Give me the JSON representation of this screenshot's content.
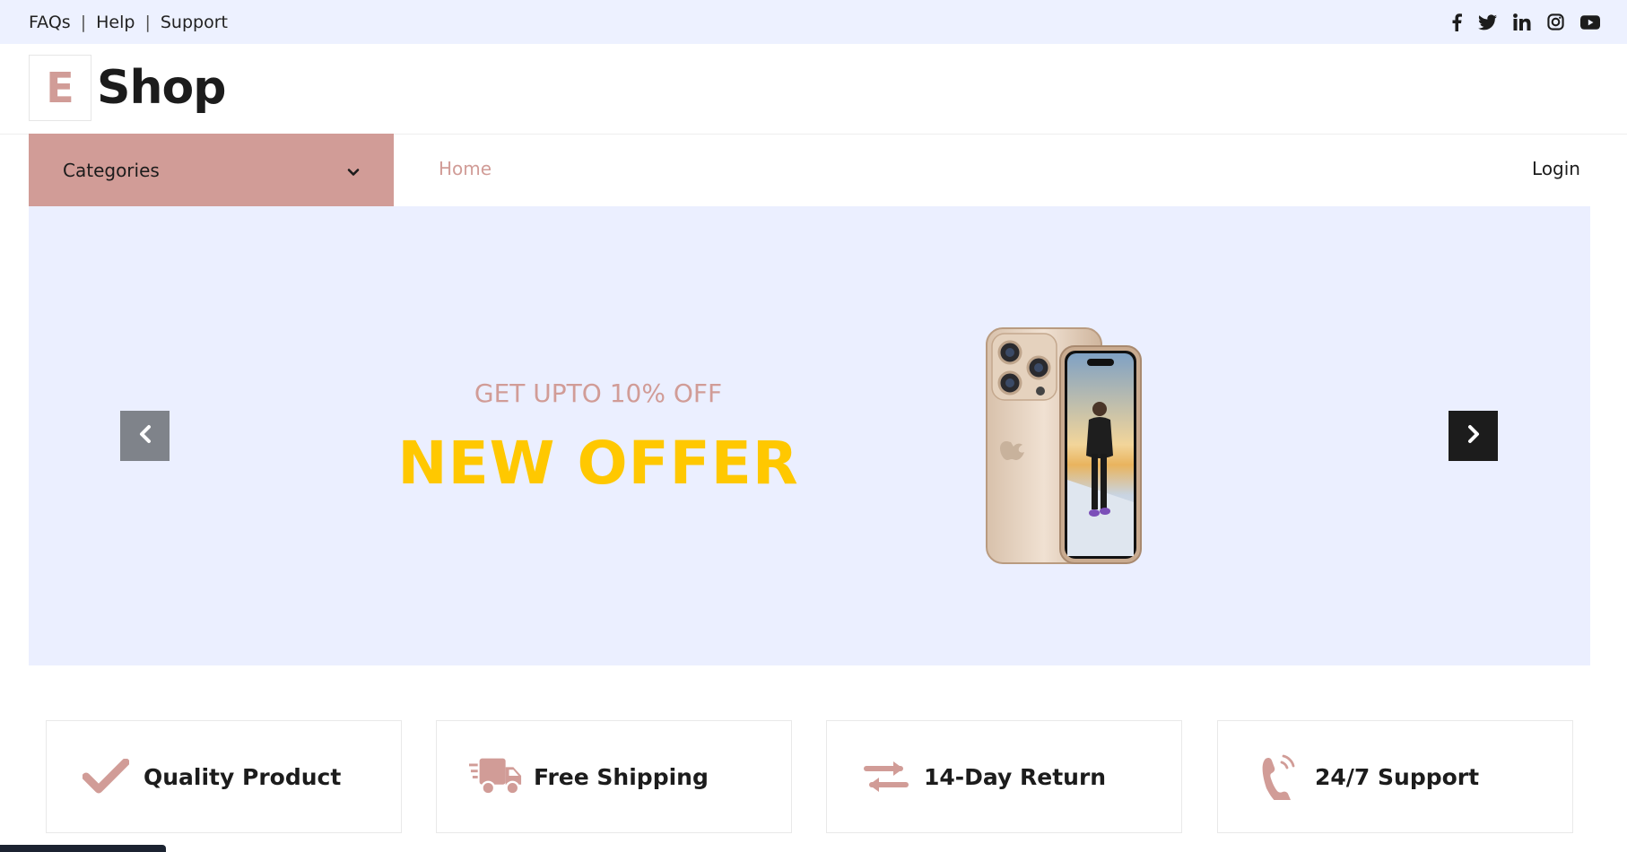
{
  "topbar": {
    "links": [
      "FAQs",
      "Help",
      "Support"
    ],
    "separator": "|",
    "social_icons": [
      "facebook-icon",
      "twitter-icon",
      "linkedin-icon",
      "instagram-icon",
      "youtube-icon"
    ]
  },
  "brand": {
    "letter": "E",
    "name": "Shop"
  },
  "nav": {
    "categories_label": "Categories",
    "links": [
      "Home"
    ],
    "login_label": "Login"
  },
  "hero": {
    "subtitle": "GET UPTO 10% OFF",
    "title": "NEW OFFER",
    "prev_icon": "chevron-left-icon",
    "next_icon": "chevron-right-icon"
  },
  "features": [
    {
      "icon": "check-icon",
      "label": "Quality Product"
    },
    {
      "icon": "truck-icon",
      "label": "Free Shipping"
    },
    {
      "icon": "exchange-icon",
      "label": "14-Day Return"
    },
    {
      "icon": "phone-icon",
      "label": "24/7 Support"
    }
  ],
  "colors": {
    "primary": "#d19c97",
    "secondary": "#ebefff",
    "accent": "#ffc800",
    "dark": "#1c1c1c"
  }
}
